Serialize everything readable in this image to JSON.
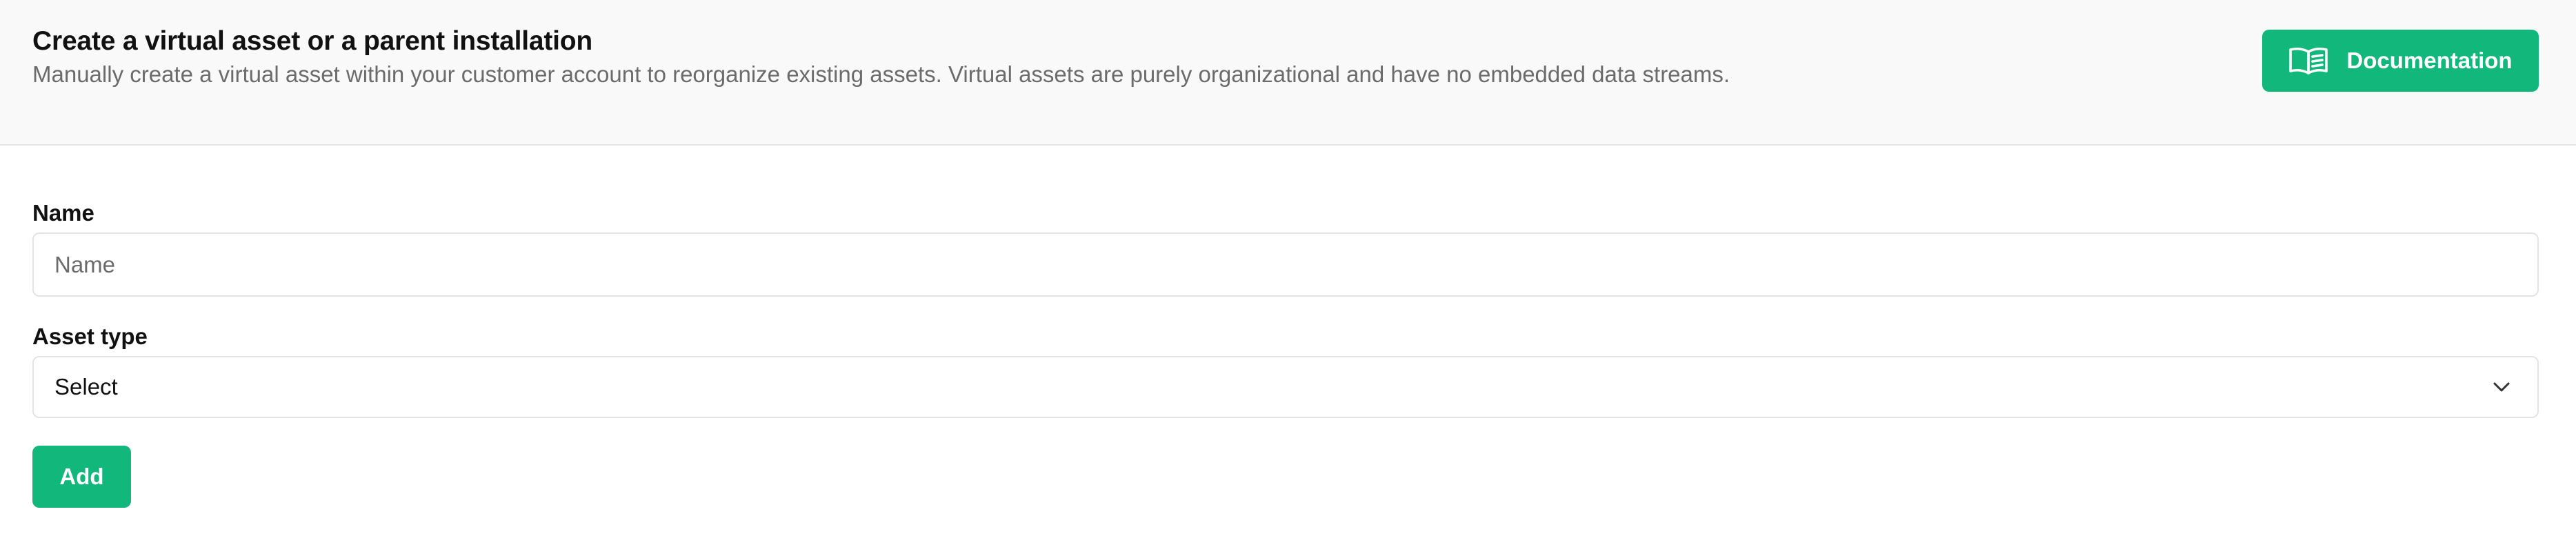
{
  "header": {
    "title": "Create a virtual asset or a parent installation",
    "description": "Manually create a virtual asset within your customer account to reorganize existing assets. Virtual assets are purely organizational and have no embedded data streams.",
    "documentation_button": {
      "label": "Documentation",
      "icon": "book-open-icon"
    }
  },
  "form": {
    "name": {
      "label": "Name",
      "placeholder": "Name",
      "value": ""
    },
    "asset_type": {
      "label": "Asset type",
      "selected": "Select",
      "icon": "chevron-down-icon"
    },
    "submit": {
      "label": "Add"
    }
  },
  "colors": {
    "accent": "#12b77c",
    "header_bg": "#f9f9f9",
    "border": "#e4e4e7",
    "muted_text": "#6b6b6b",
    "text": "#111111"
  }
}
